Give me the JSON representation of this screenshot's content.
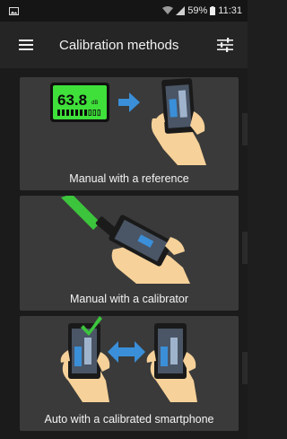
{
  "status_bar": {
    "battery": "59%",
    "time": "11:31"
  },
  "app_bar": {
    "title": "Calibration methods"
  },
  "meter": {
    "value": "63.8",
    "unit": "dB"
  },
  "cards": [
    {
      "caption": "Manual with a reference"
    },
    {
      "caption": "Manual with a calibrator"
    },
    {
      "caption": "Auto with a calibrated smartphone"
    }
  ],
  "colors": {
    "meter_green": "#3fe03a",
    "arrow_blue": "#3a8fd8",
    "hand": "#f6d199",
    "card_bg": "#3a3a3a"
  }
}
